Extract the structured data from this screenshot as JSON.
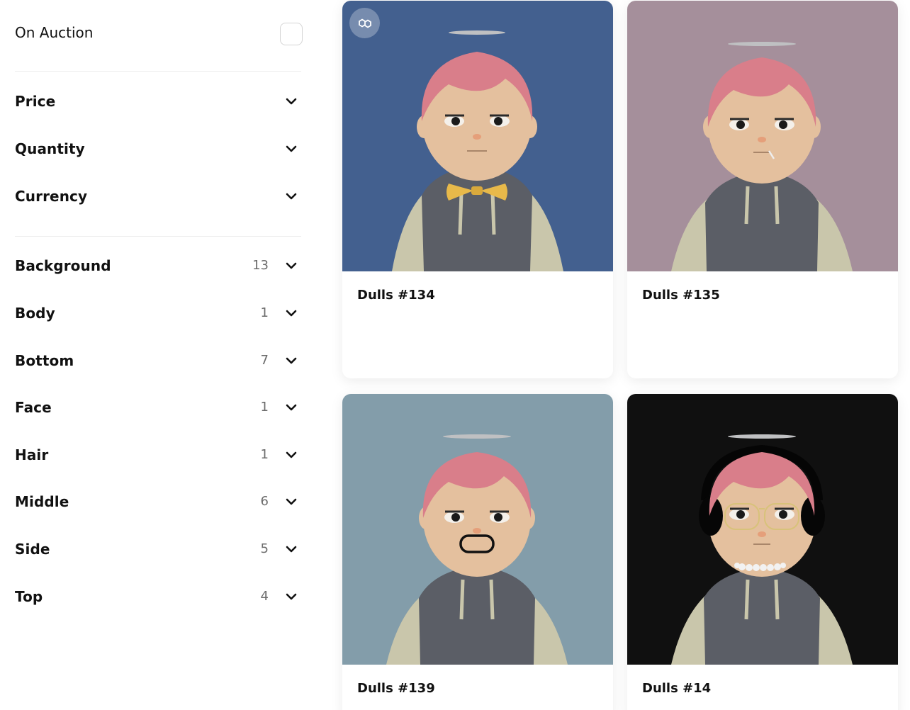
{
  "sidebar": {
    "on_auction_label": "On Auction",
    "filters": [
      {
        "label": "Price",
        "count": ""
      },
      {
        "label": "Quantity",
        "count": ""
      },
      {
        "label": "Currency",
        "count": ""
      }
    ],
    "traits": [
      {
        "label": "Background",
        "count": "13"
      },
      {
        "label": "Body",
        "count": "1"
      },
      {
        "label": "Bottom",
        "count": "7"
      },
      {
        "label": "Face",
        "count": "1"
      },
      {
        "label": "Hair",
        "count": "1"
      },
      {
        "label": "Middle",
        "count": "6"
      },
      {
        "label": "Side",
        "count": "5"
      },
      {
        "label": "Top",
        "count": "4"
      }
    ]
  },
  "cards": [
    {
      "title": "Dulls #134",
      "background": "#43608f",
      "accessory": "bowtie",
      "chain_icon": "polygon-icon"
    },
    {
      "title": "Dulls #135",
      "background": "#a58f9b",
      "accessory": "toothpick"
    },
    {
      "title": "Dulls #139",
      "background": "#839daa",
      "accessory": "mustache"
    },
    {
      "title": "Dulls #14",
      "background": "#101010",
      "accessory": "headphones-glasses-pearls"
    }
  ],
  "colors": {
    "hair": "#d97e8a",
    "skin": "#e4c09e",
    "hoodie": "#5b5e66",
    "sleeve": "#c9c6ab",
    "halo": "#bfc0c2"
  }
}
